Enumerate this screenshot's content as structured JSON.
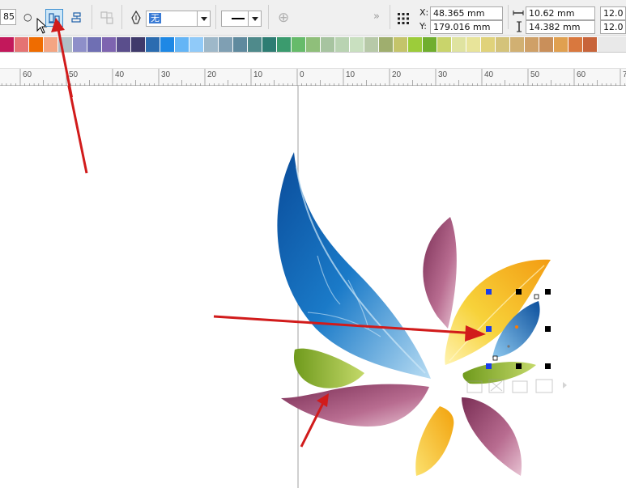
{
  "toolbar": {
    "field_left_value": "85",
    "circle_symbol": "○",
    "fill_value": "无",
    "more_symbol": "»",
    "plus_symbol": "⊕"
  },
  "position": {
    "x_label": "X:",
    "x_value": "48.365 mm",
    "y_label": "Y:",
    "y_value": "179.016 mm"
  },
  "size": {
    "width_value": "10.62 mm",
    "height_value": "14.382 mm",
    "scale_x_value": "12.0",
    "scale_y_value": "12.0"
  },
  "palette": {
    "colors": [
      "#c2185b",
      "#e57373",
      "#ef6c00",
      "#f4a582",
      "#b0bec5",
      "#8e8fc9",
      "#6f6fb3",
      "#7e64b0",
      "#5a4e8c",
      "#3f3a6b",
      "#2b6cb0",
      "#1e88e5",
      "#64b5f6",
      "#90caf9",
      "#9eb8c9",
      "#7f9fb3",
      "#5f8a9e",
      "#4f8a8b",
      "#2e7d73",
      "#3b9b6e",
      "#66bb6a",
      "#8fbf7a",
      "#a7c4a0",
      "#b9d3b2",
      "#c9e0c0",
      "#b7c9a8",
      "#9fae6e",
      "#c4c46a",
      "#9ccc3a",
      "#6fae2e",
      "#c9d46b",
      "#dfe3a0",
      "#e8e49a",
      "#e0d27a",
      "#d4c37a",
      "#d1b072",
      "#cfa067",
      "#c98f5a",
      "#e0a050",
      "#d9783e",
      "#c8643a"
    ]
  },
  "ruler": {
    "labels": [
      "60",
      "50",
      "40",
      "30",
      "20",
      "10",
      "0",
      "10",
      "20",
      "30",
      "40",
      "50",
      "60",
      "70"
    ]
  }
}
